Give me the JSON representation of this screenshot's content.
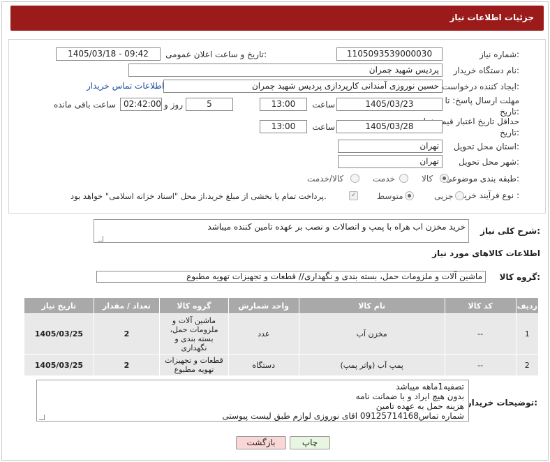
{
  "header": {
    "title": "جزئیات اطلاعات نیاز"
  },
  "form": {
    "need_number": {
      "label": "شماره نیاز:",
      "value": "1105093539000030"
    },
    "announce_datetime": {
      "label": "تاریخ و ساعت اعلان عمومی:",
      "value": "1405/03/18 - 09:42"
    },
    "buyer_org": {
      "label": "نام دستگاه خریدار:",
      "value": "پردیس شهید چمران"
    },
    "requester": {
      "label": "ایجاد کننده درخواست:",
      "value": "حسین نوروزی آمندانی کارپردازی  پردیس شهید چمران",
      "contact_link": "اطلاعات تماس خریدار"
    },
    "reply_deadline": {
      "label": "مهلت ارسال پاسخ: تا تاریخ:",
      "date": "1405/03/23",
      "time_label": "ساعت",
      "time": "13:00",
      "days": "5",
      "days_label": "روز و",
      "remaining": "02:42:00",
      "remaining_label": "ساعت باقی مانده"
    },
    "price_validity": {
      "label": "حداقل تاریخ اعتبار قیمت: تا تاریخ:",
      "date": "1405/03/28",
      "time_label": "ساعت",
      "time": "13:00"
    },
    "delivery_province": {
      "label": "استان محل تحویل:",
      "value": "تهران"
    },
    "delivery_city": {
      "label": "شهر محل تحویل:",
      "value": "تهران"
    },
    "category": {
      "label": "طبقه بندی موضوعی:",
      "options": [
        "کالا",
        "خدمت",
        "کالا/خدمت"
      ],
      "selected": "کالا"
    },
    "purchase_type": {
      "label": "نوع فرآیند خرید :",
      "options": [
        "جزیی",
        "متوسط"
      ],
      "selected": "متوسط",
      "note": "پرداخت تمام یا بخشی از مبلغ خرید،از محل \"اسناد خزانه اسلامی\" خواهد بود."
    }
  },
  "general_description": {
    "label": "شرح کلی نیاز:",
    "value": "خرید مخزن اب هراه با پمپ و اتصالات و نصب بر عهده تامین کننده میباشد"
  },
  "goods_section": {
    "title": "اطلاعات کالاهای مورد نیاز"
  },
  "goods_group": {
    "label": "گروه کالا:",
    "value": "ماشین آلات و ملزومات حمل، بسته بندی و نگهداری//  قطعات و تجهیزات تهویه مطبوع"
  },
  "table": {
    "headers": [
      "ردیف",
      "کد کالا",
      "نام کالا",
      "واحد شمارش",
      "گروه کالا",
      "تعداد / مقدار",
      "تاریخ نیاز"
    ],
    "rows": [
      [
        "1",
        "--",
        "مخزن آب",
        "عدد",
        "ماشین آلات و ملزومات حمل، بسته بندی و نگهداری",
        "2",
        "1405/03/25"
      ],
      [
        "2",
        "--",
        "پمپ آب (واتر پمپ)",
        "دستگاه",
        "قطعات و تجهیزات تهویه مطبوع",
        "2",
        "1405/03/25"
      ]
    ]
  },
  "buyer_notes": {
    "label": "توضیحات خریدار:",
    "lines": [
      "تصفیه1ماهه میباشد",
      "بدون هیچ ایراد و با ضمانت نامه",
      "هزینه حمل به عهده تامین",
      "شماره تماس09125714168 اقای نوروزی لوازم طبق لیست پیوستی"
    ]
  },
  "buttons": {
    "print": "چاپ",
    "back": "بازگشت"
  },
  "colors": {
    "header_bg": "#9b1b1b",
    "table_header_bg": "#a9a9a9",
    "table_row_bg": "#e9e9e9",
    "link": "#1a4fa0"
  }
}
